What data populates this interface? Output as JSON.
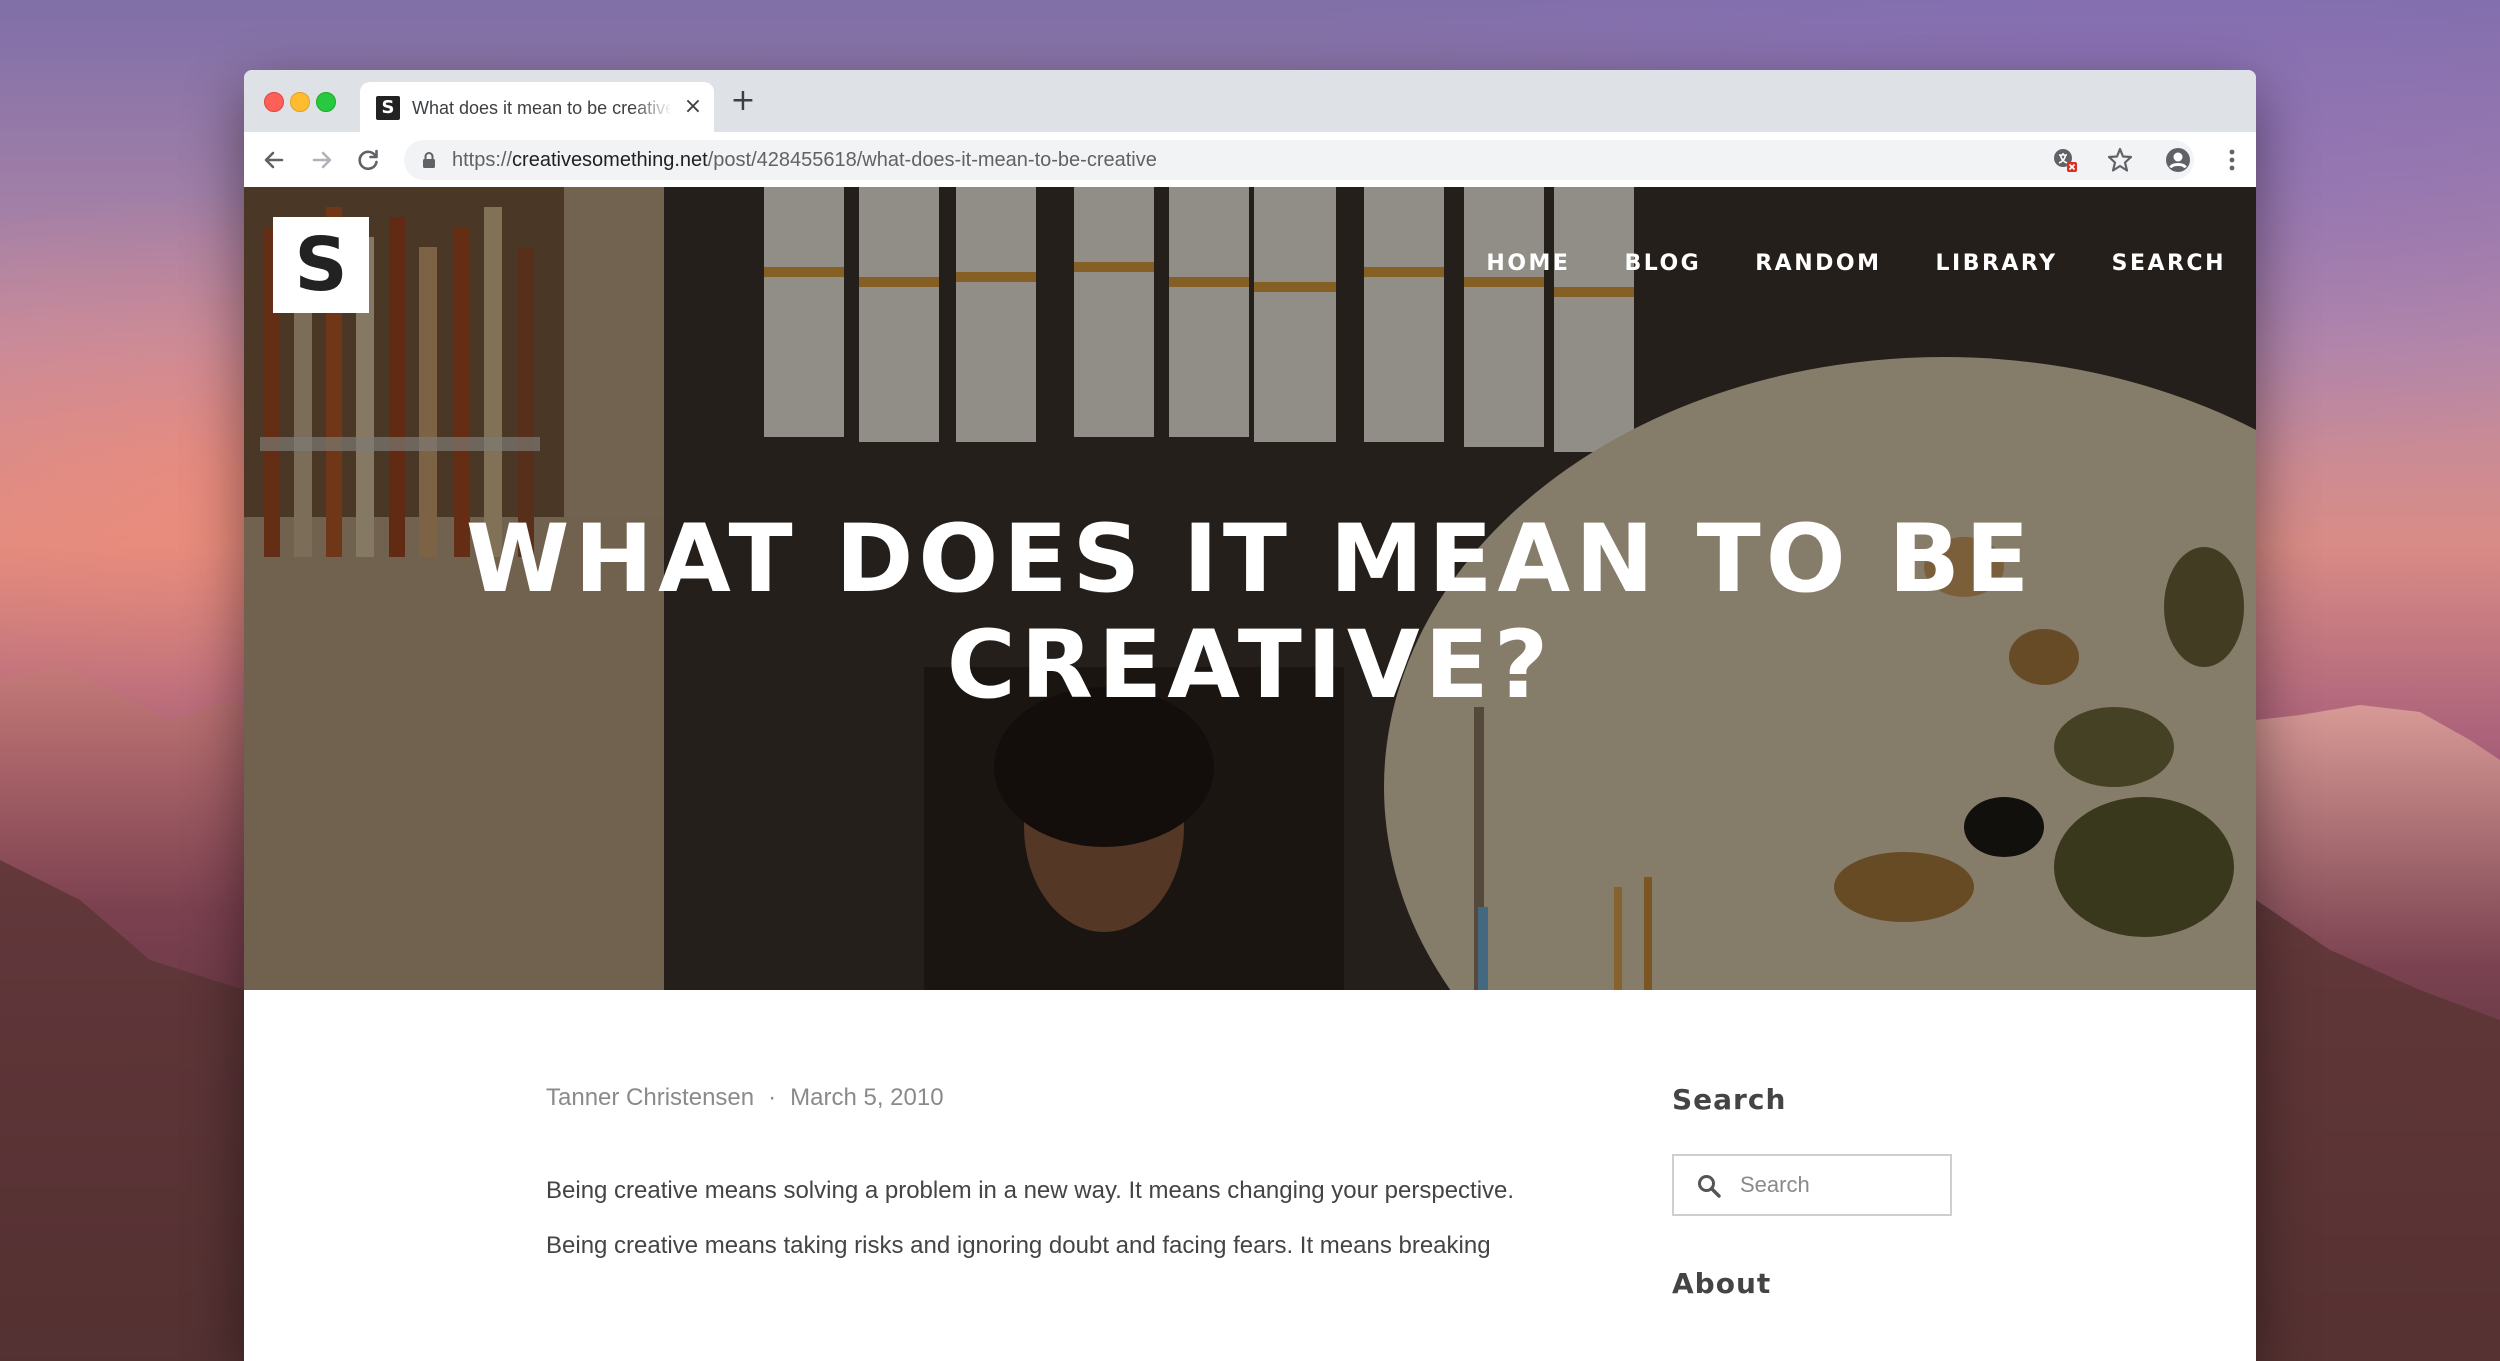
{
  "browser": {
    "tab": {
      "favicon_letter": "S",
      "title": "What does it mean to be creative?",
      "close_glyph": "×"
    },
    "new_tab_glyph": "+",
    "address": {
      "scheme": "https://",
      "host": "creativesomething.net",
      "path": "/post/428455618/what-does-it-mean-to-be-creative"
    },
    "icons": {
      "back": "back-arrow-icon",
      "forward": "forward-arrow-icon",
      "reload": "reload-icon",
      "lock": "lock-icon",
      "translate": "translate-icon",
      "bookmark": "star-icon",
      "profile": "profile-icon",
      "menu": "kebab-menu-icon"
    }
  },
  "site": {
    "logo_letter": "S",
    "nav": {
      "home": "HOME",
      "blog": "BLOG",
      "random": "RANDOM",
      "library": "LIBRARY",
      "search": "SEARCH"
    }
  },
  "post": {
    "title": "WHAT DOES IT MEAN TO BE CREATIVE?",
    "author": "Tanner Christensen",
    "separator": "·",
    "date": "March 5, 2010",
    "paragraphs": [
      "Being creative means solving a problem in a new way. It means changing your perspective.",
      "Being creative means taking risks and ignoring doubt and facing fears. It means breaking"
    ]
  },
  "sidebar": {
    "search_heading": "Search",
    "search_placeholder": "Search",
    "about_heading": "About"
  },
  "colors": {
    "tab_bar": "#dee1e6",
    "omnibox": "#f1f3f4",
    "traffic_red": "#fe5f57",
    "traffic_yellow": "#febc2e",
    "traffic_green": "#28c840",
    "body_text": "#444444",
    "meta_text": "#8a8a8a"
  }
}
